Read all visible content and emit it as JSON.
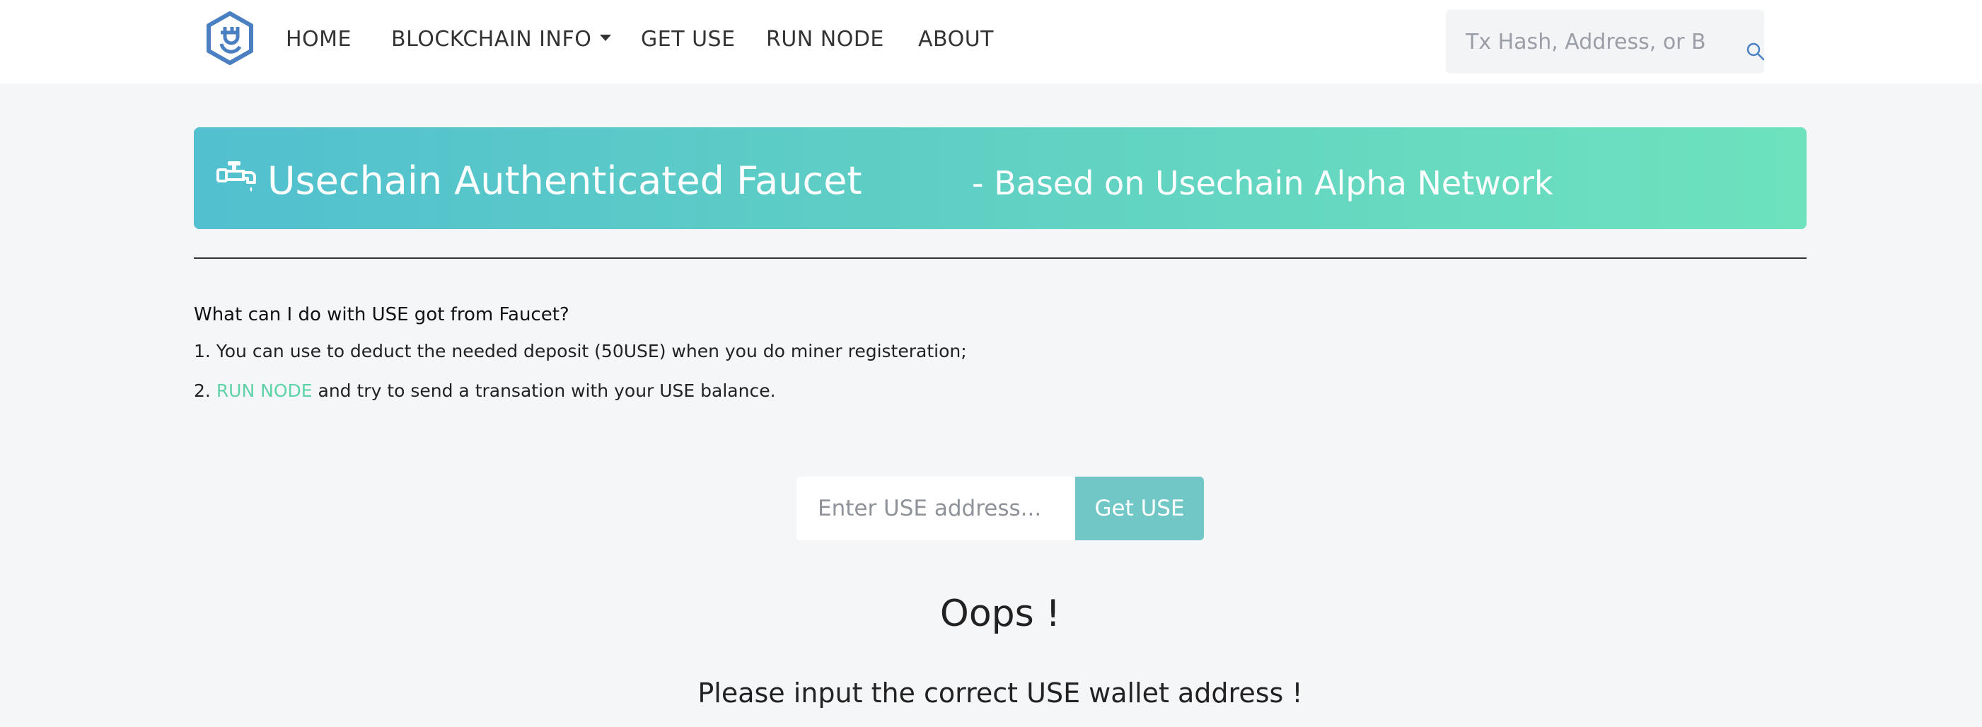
{
  "nav": {
    "items": [
      {
        "label": "HOME"
      },
      {
        "label": "BLOCKCHAIN INFO"
      },
      {
        "label": "GET USE"
      },
      {
        "label": "RUN NODE"
      },
      {
        "label": "ABOUT"
      }
    ],
    "search_placeholder": "Tx Hash, Address, or Block"
  },
  "banner": {
    "title": "Usechain Authenticated Faucet",
    "subtitle": "- Based on Usechain Alpha Network"
  },
  "info": {
    "question": "What can I do with USE got from Faucet?",
    "line1": "1. You can use to deduct the needed deposit (50USE) when you do miner registeration;",
    "line2_prefix": "2. ",
    "line2_link": "RUN NODE",
    "line2_suffix": " and try to send a transation with your USE balance."
  },
  "form": {
    "address_placeholder": "Enter USE address...",
    "button_label": "Get USE"
  },
  "result": {
    "title": "Oops !",
    "message": "Please input the correct USE wallet address !"
  },
  "colors": {
    "banner_start": "#52c0cf",
    "banner_end": "#6de2bd",
    "link_green": "#5fd3a8",
    "button_bg": "#71c7c6",
    "logo_blue": "#4a7fc1"
  }
}
